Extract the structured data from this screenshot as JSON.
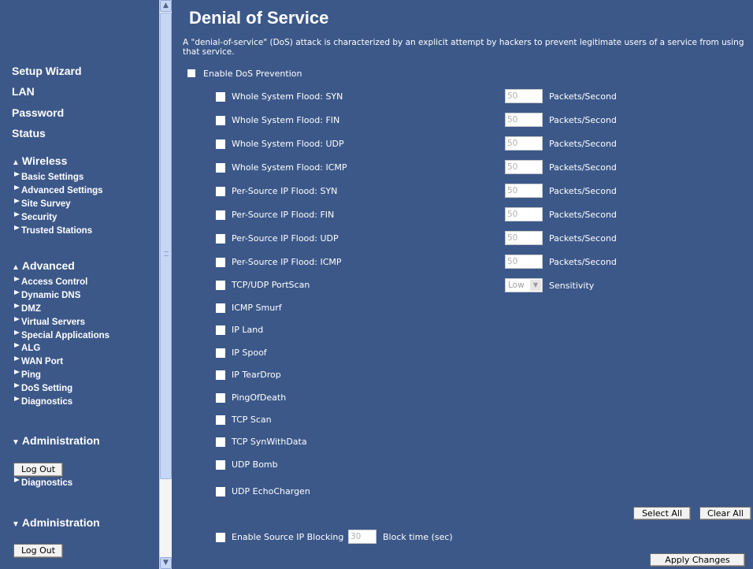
{
  "sidebar": {
    "main_links": [
      "Setup Wizard",
      "LAN",
      "Password",
      "Status"
    ],
    "wireless": {
      "label": "Wireless",
      "items": [
        "Basic Settings",
        "Advanced Settings",
        "Site Survey",
        "Security",
        "Trusted Stations"
      ]
    },
    "advanced": {
      "label": "Advanced",
      "items": [
        "Access Control",
        "Dynamic DNS",
        "DMZ",
        "Virtual Servers",
        "Special Applications",
        "ALG",
        "WAN Port",
        "Ping",
        "DoS Setting",
        "Diagnostics"
      ]
    },
    "administration_label": "Administration",
    "logout_label": "Log Out",
    "stray_item": "Diagnostics"
  },
  "main": {
    "title": "Denial of Service",
    "description": "A \"denial-of-service\" (DoS) attack is characterized by an explicit attempt by hackers to prevent legitimate users of a service from using that service.",
    "enable_dos_label": "Enable DoS Prevention",
    "flood_options": [
      {
        "label": "Whole System Flood: SYN",
        "value": "50"
      },
      {
        "label": "Whole System Flood: FIN",
        "value": "50"
      },
      {
        "label": "Whole System Flood: UDP",
        "value": "50"
      },
      {
        "label": "Whole System Flood: ICMP",
        "value": "50"
      },
      {
        "label": "Per-Source IP Flood: SYN",
        "value": "50"
      },
      {
        "label": "Per-Source IP Flood: FIN",
        "value": "50"
      },
      {
        "label": "Per-Source IP Flood: UDP",
        "value": "50"
      },
      {
        "label": "Per-Source IP Flood: ICMP",
        "value": "50"
      }
    ],
    "packets_unit": "Packets/Second",
    "portscan_label": "TCP/UDP PortScan",
    "sensitivity_value": "Low",
    "sensitivity_label": "Sensitivity",
    "other_options": [
      "ICMP Smurf",
      "IP Land",
      "IP Spoof",
      "IP TearDrop",
      "PingOfDeath",
      "TCP Scan",
      "TCP SynWithData",
      "UDP Bomb",
      "UDP EchoChargen"
    ],
    "select_all_label": "Select All",
    "clear_all_label": "Clear All",
    "source_blocking_label": "Enable Source IP Blocking",
    "block_time_value": "30",
    "block_time_label": "Block time (sec)",
    "apply_label": "Apply Changes"
  }
}
